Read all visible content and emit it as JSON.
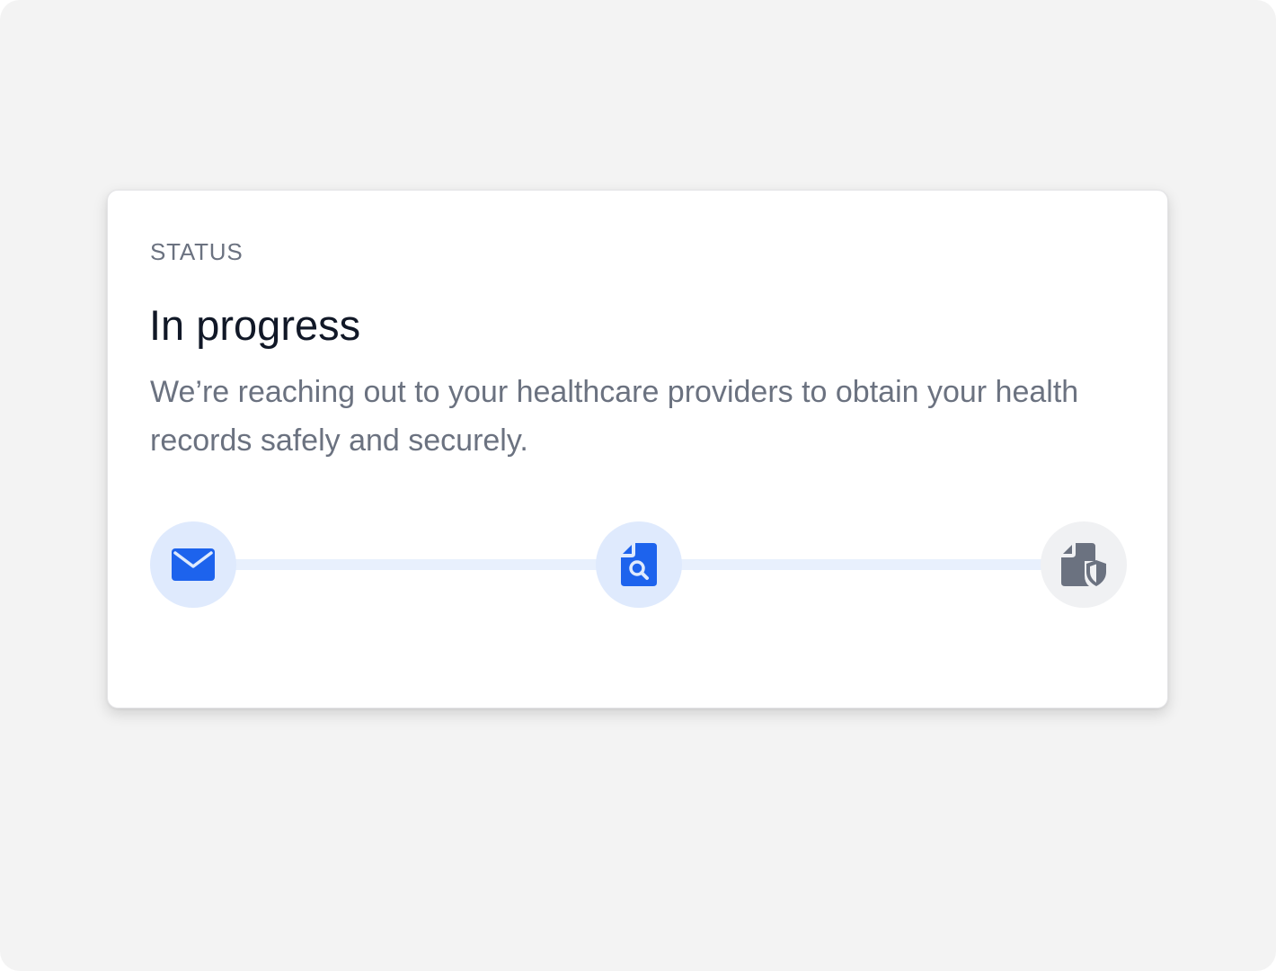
{
  "status_card": {
    "eyebrow": "STATUS",
    "title": "In progress",
    "description": "We’re reaching out to your healthcare providers to obtain your health records safely and securely."
  },
  "progress": {
    "steps": [
      {
        "icon": "envelope-icon",
        "state": "active",
        "color": "#1d63ed"
      },
      {
        "icon": "document-search-icon",
        "state": "active",
        "color": "#1d63ed"
      },
      {
        "icon": "document-shield-icon",
        "state": "pending",
        "color": "#6b7280"
      }
    ]
  }
}
